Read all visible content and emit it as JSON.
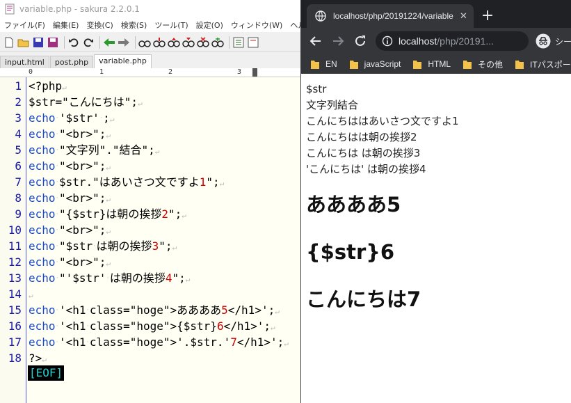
{
  "editor": {
    "title": "variable.php - sakura 2.2.0.1",
    "menu": [
      "ファイル(F)",
      "編集(E)",
      "変換(C)",
      "検索(S)",
      "ツール(T)",
      "設定(O)",
      "ウィンドウ(W)",
      "ヘル"
    ],
    "tabs": [
      "input.html",
      "post.php",
      "variable.php"
    ],
    "active_tab": "variable.php",
    "ruler_labels": [
      "0",
      "1",
      "2",
      "3"
    ],
    "line_numbers": [
      "1",
      "2",
      "3",
      "4",
      "5",
      "6",
      "7",
      "8",
      "9",
      "10",
      "11",
      "12",
      "13",
      "14",
      "15",
      "16",
      "17",
      "18"
    ],
    "eof_marker": "[EOF]"
  },
  "code_lines": [
    [
      [
        "t",
        "<?php"
      ],
      [
        "nl",
        "↵"
      ]
    ],
    [
      [
        "t",
        "$str=\"こんにちは\";"
      ],
      [
        "nl",
        "↵"
      ]
    ],
    [
      [
        "k",
        "echo"
      ],
      [
        "sp",
        "·"
      ],
      [
        "t",
        "'$str'"
      ],
      [
        "sp",
        "·"
      ],
      [
        "t",
        ";"
      ],
      [
        "nl",
        "↵"
      ]
    ],
    [
      [
        "k",
        "echo"
      ],
      [
        "sp",
        "·"
      ],
      [
        "t",
        "\"<br>\";"
      ],
      [
        "nl",
        "↵"
      ]
    ],
    [
      [
        "k",
        "echo"
      ],
      [
        "sp",
        "·"
      ],
      [
        "t",
        "\"文字列\".\"結合\";"
      ],
      [
        "nl",
        "↵"
      ]
    ],
    [
      [
        "k",
        "echo"
      ],
      [
        "sp",
        "·"
      ],
      [
        "t",
        "\"<br>\";"
      ],
      [
        "nl",
        "↵"
      ]
    ],
    [
      [
        "k",
        "echo"
      ],
      [
        "sp",
        "·"
      ],
      [
        "t",
        "$str.\"はあいさつ文ですよ"
      ],
      [
        "n",
        "1"
      ],
      [
        "t",
        "\";"
      ],
      [
        "nl",
        "↵"
      ]
    ],
    [
      [
        "k",
        "echo"
      ],
      [
        "sp",
        "·"
      ],
      [
        "t",
        "\"<br>\";"
      ],
      [
        "nl",
        "↵"
      ]
    ],
    [
      [
        "k",
        "echo"
      ],
      [
        "sp",
        "·"
      ],
      [
        "t",
        "\"{$str}は朝の挨拶"
      ],
      [
        "n",
        "2"
      ],
      [
        "t",
        "\";"
      ],
      [
        "nl",
        "↵"
      ]
    ],
    [
      [
        "k",
        "echo"
      ],
      [
        "sp",
        "·"
      ],
      [
        "t",
        "\"<br>\";"
      ],
      [
        "nl",
        "↵"
      ]
    ],
    [
      [
        "k",
        "echo"
      ],
      [
        "sp",
        "·"
      ],
      [
        "t",
        "\"$str"
      ],
      [
        "sp",
        "·"
      ],
      [
        "t",
        "は朝の挨拶"
      ],
      [
        "n",
        "3"
      ],
      [
        "t",
        "\";"
      ],
      [
        "nl",
        "↵"
      ]
    ],
    [
      [
        "k",
        "echo"
      ],
      [
        "sp",
        "·"
      ],
      [
        "t",
        "\"<br>\";"
      ],
      [
        "nl",
        "↵"
      ]
    ],
    [
      [
        "k",
        "echo"
      ],
      [
        "sp",
        "·"
      ],
      [
        "t",
        "\"'$str'"
      ],
      [
        "sp",
        "·"
      ],
      [
        "t",
        "は朝の挨拶"
      ],
      [
        "n",
        "4"
      ],
      [
        "t",
        "\";"
      ],
      [
        "nl",
        "↵"
      ]
    ],
    [
      [
        "nl",
        "↵"
      ]
    ],
    [
      [
        "k",
        "echo"
      ],
      [
        "sp",
        "·"
      ],
      [
        "t",
        "'<h1"
      ],
      [
        "sp",
        "·"
      ],
      [
        "t",
        "class=\"hoge\">ああああ"
      ],
      [
        "n",
        "5"
      ],
      [
        "t",
        "</h1>';"
      ],
      [
        "nl",
        "↵"
      ]
    ],
    [
      [
        "k",
        "echo"
      ],
      [
        "sp",
        "·"
      ],
      [
        "t",
        "'<h1"
      ],
      [
        "sp",
        "·"
      ],
      [
        "t",
        "class=\"hoge\">{$str}"
      ],
      [
        "n",
        "6"
      ],
      [
        "t",
        "</h1>';"
      ],
      [
        "nl",
        "↵"
      ]
    ],
    [
      [
        "k",
        "echo"
      ],
      [
        "sp",
        "·"
      ],
      [
        "t",
        "'<h1"
      ],
      [
        "sp",
        "·"
      ],
      [
        "t",
        "class=\"hoge\">'.$str.'"
      ],
      [
        "n",
        "7"
      ],
      [
        "t",
        "</h1>';"
      ],
      [
        "nl",
        "↵"
      ]
    ],
    [
      [
        "t",
        "?>"
      ],
      [
        "nl",
        "↵"
      ]
    ]
  ],
  "browser": {
    "tab_title": "localhost/php/20191224/variable",
    "tab_close": "✕",
    "new_tab": "+",
    "url_host": "localhost",
    "url_path": "/php/20191...",
    "profile_label": "シーク",
    "bookmarks": [
      "EN",
      "javaScript",
      "HTML",
      "その他",
      "ITパスポート"
    ],
    "page_lines": [
      "$str",
      "文字列結合",
      "こんにちははあいさつ文ですよ1",
      "こんにちはは朝の挨拶2",
      "こんにちは は朝の挨拶3",
      "'こんにちは' は朝の挨拶4"
    ],
    "page_headings": [
      "ああああ5",
      "{$str}6",
      "こんにちは7"
    ]
  },
  "colors": {
    "keyword": "#1848c8",
    "number": "#d00000",
    "line_number": "#1a1aa8",
    "eof_text": "#22d0d0",
    "chrome_dark": "#202124",
    "chrome_toolbar": "#35363a",
    "folder": "#f2c249"
  },
  "icons": [
    "sakura-app-icon",
    "new-file-icon",
    "open-folder-icon",
    "save-icon",
    "save-all-icon",
    "undo-icon",
    "redo-icon",
    "find-icon",
    "chrome-favicon",
    "back-icon",
    "forward-icon",
    "reload-icon",
    "info-icon",
    "star-icon",
    "incognito-icon",
    "folder-icon"
  ]
}
